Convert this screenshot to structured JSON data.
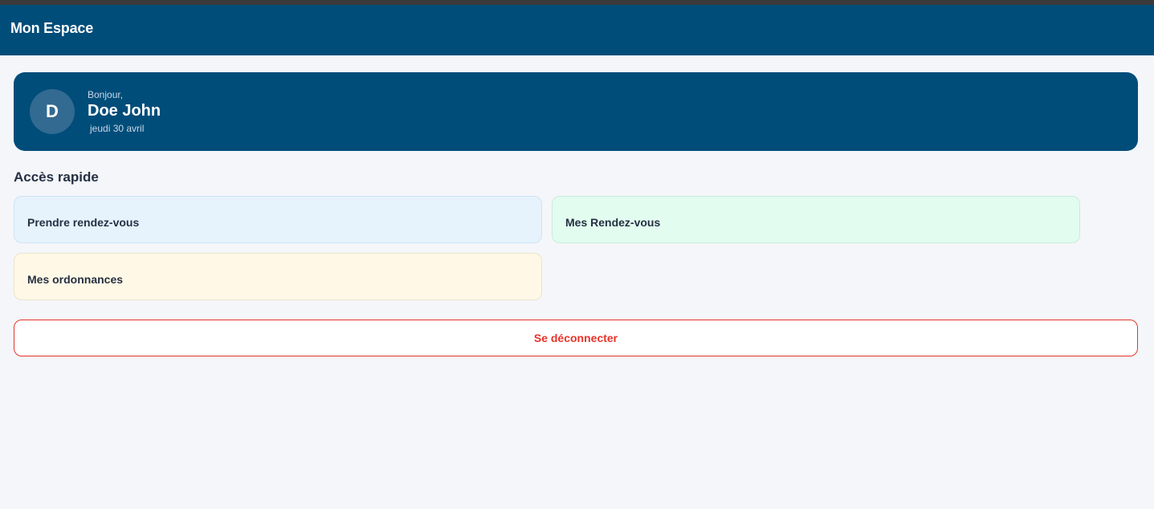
{
  "header": {
    "title": "Mon Espace"
  },
  "welcome": {
    "avatar_initial": "D",
    "greeting": "Bonjour,",
    "user_name": "Doe John",
    "date": "jeudi 30 avril"
  },
  "quick_access": {
    "title": "Accès rapide",
    "items": [
      {
        "label": "Prendre rendez-vous",
        "color": "#e6f3fd"
      },
      {
        "label": "Mes Rendez-vous",
        "color": "#e2fcef"
      },
      {
        "label": "Mes ordonnances",
        "color": "#fff8e6"
      }
    ]
  },
  "logout": {
    "label": "Se déconnecter",
    "color": "#e8332a"
  },
  "colors": {
    "brand": "#004d7a",
    "background": "#f4f6fa"
  }
}
